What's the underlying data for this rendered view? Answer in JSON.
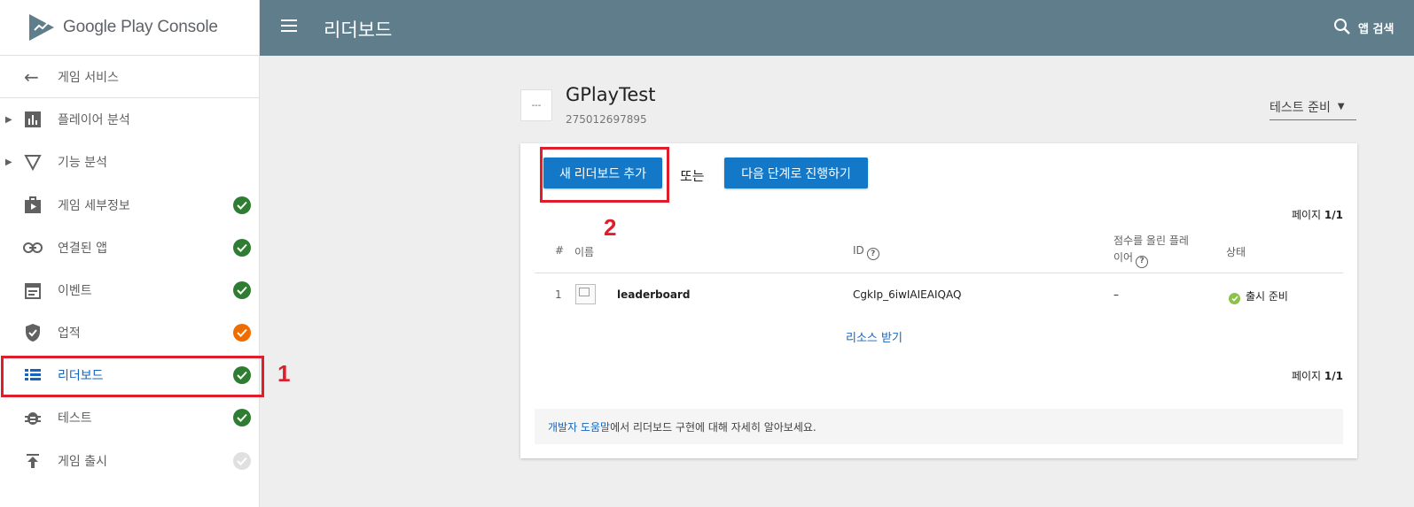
{
  "sidebar": {
    "logo": {
      "brand": "Google Play",
      "product": "Console"
    },
    "back_label": "게임 서비스",
    "items": [
      {
        "label": "플레이어 분석",
        "icon": "bar-chart-icon",
        "expandable": true,
        "status": "none"
      },
      {
        "label": "기능 분석",
        "icon": "triangle-filter-icon",
        "expandable": true,
        "status": "none"
      },
      {
        "label": "게임 세부정보",
        "icon": "game-details-icon",
        "expandable": false,
        "status": "complete"
      },
      {
        "label": "연결된 앱",
        "icon": "link-icon",
        "expandable": false,
        "status": "complete"
      },
      {
        "label": "이벤트",
        "icon": "calendar-icon",
        "expandable": false,
        "status": "complete"
      },
      {
        "label": "업적",
        "icon": "shield-icon",
        "expandable": false,
        "status": "warning"
      },
      {
        "label": "리더보드",
        "icon": "list-icon",
        "expandable": false,
        "status": "complete",
        "active": true
      },
      {
        "label": "테스트",
        "icon": "bug-icon",
        "expandable": false,
        "status": "complete"
      },
      {
        "label": "게임 출시",
        "icon": "publish-icon",
        "expandable": false,
        "status": "disabled"
      }
    ],
    "callout_number": "1"
  },
  "topbar": {
    "title": "리더보드",
    "search_text": "앱 검색"
  },
  "game": {
    "thumb_text": "---",
    "name": "GPlayTest",
    "id": "275012697895",
    "status_dropdown": "테스트 준비"
  },
  "card": {
    "add_button": "새 리더보드 추가",
    "or_text": "또는",
    "next_button": "다음 단계로 진행하기",
    "callout_number": "2",
    "pager": {
      "label": "페이지",
      "value": "1/1"
    },
    "columns": {
      "num": "#",
      "name": "이름",
      "id": "ID",
      "score_players_line1": "점수를 올린 플레",
      "score_players_line2": "이어",
      "status": "상태"
    },
    "rows": [
      {
        "num": "1",
        "name": "leaderboard",
        "id": "CgkIp_6iwIAIEAIQAQ",
        "players": "–",
        "status": "출시 준비"
      }
    ],
    "resource_link": "리소스 받기",
    "help": {
      "link": "개발자 도움말",
      "text": "에서 리더보드 구현에 대해 자세히 알아보세요."
    }
  },
  "colors": {
    "topbar": "#607d8b",
    "primary_button": "#1478c8",
    "complete": "#2e7d32",
    "warning": "#ef6c00",
    "disabled": "#e0e0e0",
    "ready": "#8bc34a",
    "callout": "#e01e2b"
  }
}
